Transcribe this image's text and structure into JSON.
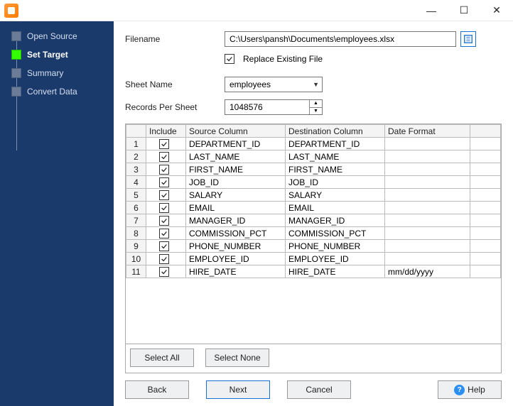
{
  "window": {
    "minimize": "—",
    "maximize": "☐",
    "close": "✕"
  },
  "sidebar": {
    "items": [
      {
        "label": "Open Source",
        "active": false
      },
      {
        "label": "Set Target",
        "active": true
      },
      {
        "label": "Summary",
        "active": false
      },
      {
        "label": "Convert Data",
        "active": false
      }
    ]
  },
  "form": {
    "filename_label": "Filename",
    "filename_value": "C:\\Users\\pansh\\Documents\\employees.xlsx",
    "browse_icon": "browse",
    "replace_label": "Replace Existing File",
    "replace_checked": true,
    "sheet_label": "Sheet Name",
    "sheet_value": "employees",
    "records_label": "Records Per Sheet",
    "records_value": "1048576"
  },
  "grid": {
    "headers": {
      "include": "Include",
      "source": "Source Column",
      "dest": "Destination Column",
      "date": "Date Format"
    },
    "rows": [
      {
        "n": "1",
        "inc": true,
        "src": "DEPARTMENT_ID",
        "dst": "DEPARTMENT_ID",
        "fmt": ""
      },
      {
        "n": "2",
        "inc": true,
        "src": "LAST_NAME",
        "dst": "LAST_NAME",
        "fmt": ""
      },
      {
        "n": "3",
        "inc": true,
        "src": "FIRST_NAME",
        "dst": "FIRST_NAME",
        "fmt": ""
      },
      {
        "n": "4",
        "inc": true,
        "src": "JOB_ID",
        "dst": "JOB_ID",
        "fmt": ""
      },
      {
        "n": "5",
        "inc": true,
        "src": "SALARY",
        "dst": "SALARY",
        "fmt": ""
      },
      {
        "n": "6",
        "inc": true,
        "src": "EMAIL",
        "dst": "EMAIL",
        "fmt": ""
      },
      {
        "n": "7",
        "inc": true,
        "src": "MANAGER_ID",
        "dst": "MANAGER_ID",
        "fmt": ""
      },
      {
        "n": "8",
        "inc": true,
        "src": "COMMISSION_PCT",
        "dst": "COMMISSION_PCT",
        "fmt": ""
      },
      {
        "n": "9",
        "inc": true,
        "src": "PHONE_NUMBER",
        "dst": "PHONE_NUMBER",
        "fmt": ""
      },
      {
        "n": "10",
        "inc": true,
        "src": "EMPLOYEE_ID",
        "dst": "EMPLOYEE_ID",
        "fmt": ""
      },
      {
        "n": "11",
        "inc": true,
        "src": "HIRE_DATE",
        "dst": "HIRE_DATE",
        "fmt": "mm/dd/yyyy"
      }
    ]
  },
  "buttons": {
    "select_all": "Select All",
    "select_none": "Select None",
    "back": "Back",
    "next": "Next",
    "cancel": "Cancel",
    "help": "Help"
  }
}
